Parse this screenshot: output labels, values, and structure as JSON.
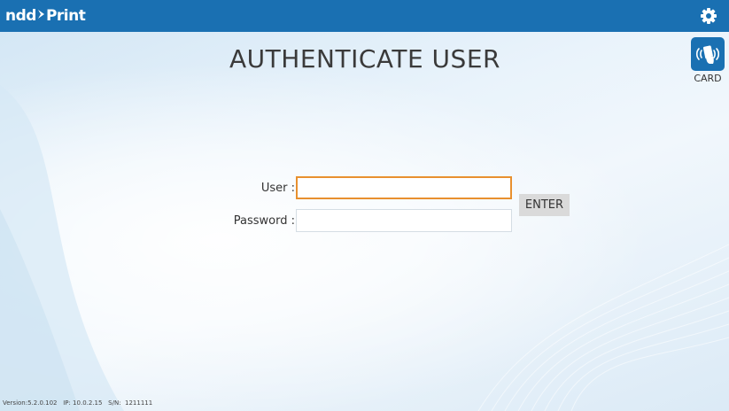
{
  "header": {
    "logo_text_left": "ndd",
    "logo_text_right": "Print",
    "settings_icon": "gear-icon"
  },
  "side": {
    "card_icon": "card-reader-icon",
    "card_label": "CARD"
  },
  "main": {
    "title": "AUTHENTICATE USER",
    "user_label": "User :",
    "user_value": "",
    "password_label": "Password :",
    "password_value": "",
    "enter_label": "ENTER"
  },
  "footer": {
    "version": "Version:5.2.0.102",
    "ip": "IP: 10.0.2.15",
    "serial": "S/N:  1211111"
  },
  "colors": {
    "topbar": "#1a70b2",
    "focus_border": "#e8902f",
    "enter_bg": "#dadada"
  }
}
